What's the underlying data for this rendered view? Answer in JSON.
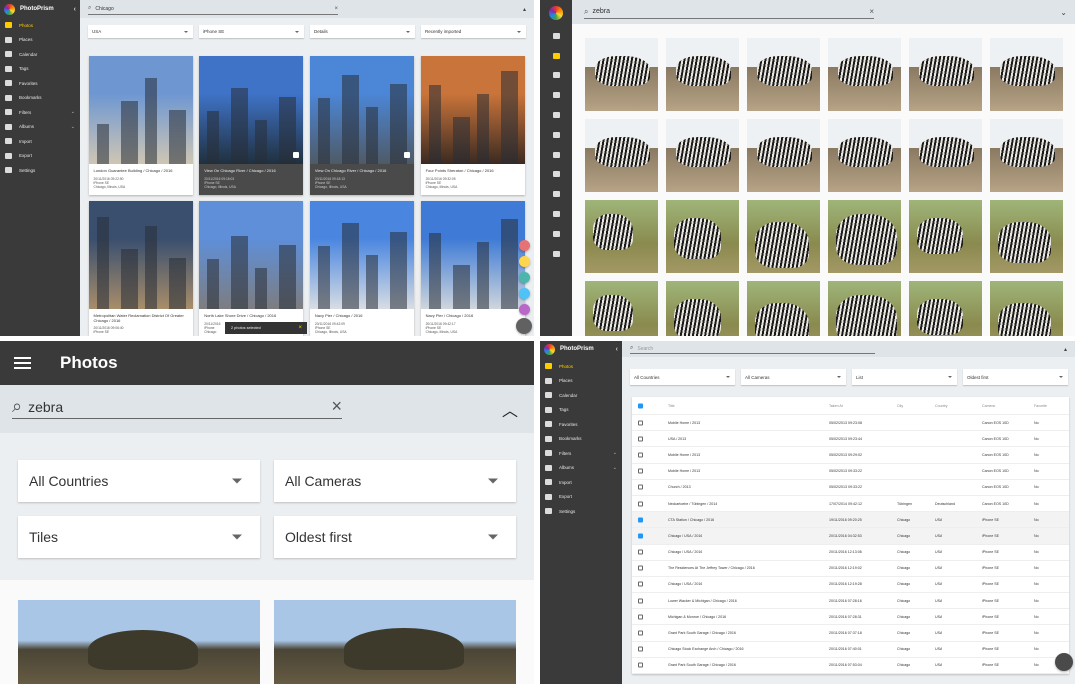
{
  "q1": {
    "brand": "PhotoPrism",
    "nav": [
      {
        "label": "Photos",
        "active": true
      },
      {
        "label": "Places"
      },
      {
        "label": "Calendar"
      },
      {
        "label": "Tags"
      },
      {
        "label": "Favorites"
      },
      {
        "label": "Bookmarks"
      },
      {
        "label": "Filters",
        "chevron": "⌄"
      },
      {
        "label": "Albums",
        "chevron": "⌄"
      },
      {
        "label": "Import"
      },
      {
        "label": "Export"
      },
      {
        "label": "Settings"
      }
    ],
    "search_value": "Chicago",
    "filters": [
      "USA",
      "iPhone SE",
      "Details",
      "Recently imported"
    ],
    "cards": [
      {
        "caption": "London Guarantee Building / Chicago / 2016",
        "meta": [
          "20/11/2016 09:22:50",
          "iPhone SE",
          "Chicago, Illinois, USA"
        ],
        "selected": false,
        "colors": [
          "#6e97d2",
          "#cfc6b4"
        ]
      },
      {
        "caption": "View On Chicago River / Chicago / 2016",
        "meta": [
          "20/11/2016 09:18:03",
          "iPhone SE",
          "Chicago, Illinois, USA"
        ],
        "selected": true,
        "colors": [
          "#3f73c7",
          "#20303e"
        ]
      },
      {
        "caption": "View On Chicago River / Chicago / 2016",
        "meta": [
          "20/11/2016 09:18:13",
          "iPhone SE",
          "Chicago, Illinois, USA"
        ],
        "selected": true,
        "colors": [
          "#4c86d6",
          "#4f5a66"
        ]
      },
      {
        "caption": "Four Points Sheraton / Chicago / 2016",
        "meta": [
          "20/11/2016 09:32:05",
          "iPhone SE",
          "Chicago, Illinois, USA"
        ],
        "selected": false,
        "colors": [
          "#c9743a",
          "#3b2a22"
        ]
      },
      {
        "caption": "Metropolitan Water Reclamation District Of Greater Chicago / 2016",
        "meta": [
          "20/11/2016 09:06:40",
          "iPhone SE"
        ],
        "selected": false,
        "colors": [
          "#3a4f6e",
          "#a88d6a"
        ]
      },
      {
        "caption": "North Lake Shore Drive / Chicago / 2016",
        "meta": [
          "20/11/2016",
          "iPhone",
          "Chicago"
        ],
        "selected": false,
        "colors": [
          "#5f8fd8",
          "#7d7d80"
        ]
      },
      {
        "caption": "Navy Pier / Chicago / 2016",
        "meta": [
          "20/11/2016 09:42:09",
          "iPhone SE",
          "Chicago, Illinois, USA"
        ],
        "selected": false,
        "colors": [
          "#4a86e0",
          "#d8dde3"
        ]
      },
      {
        "caption": "Navy Pier / Chicago / 2016",
        "meta": [
          "20/11/2016 09:42:17",
          "iPhone SE",
          "Chicago, Illinois, USA"
        ],
        "selected": false,
        "colors": [
          "#3f7bd6",
          "#cfd6dc"
        ]
      }
    ],
    "snackbar": "2 photos selected",
    "fab_colors": [
      "#e57373",
      "#ffd54f",
      "#4db6ac",
      "#4fc3f7",
      "#ba68c8",
      "#616161"
    ]
  },
  "q2": {
    "search_value": "zebra"
  },
  "q3": {
    "title": "Photos",
    "search_value": "zebra",
    "filters": [
      "All Countries",
      "All Cameras",
      "Tiles",
      "Oldest first"
    ]
  },
  "q4": {
    "brand": "PhotoPrism",
    "nav": [
      {
        "label": "Photos",
        "active": true
      },
      {
        "label": "Places"
      },
      {
        "label": "Calendar"
      },
      {
        "label": "Tags"
      },
      {
        "label": "Favorites"
      },
      {
        "label": "Bookmarks"
      },
      {
        "label": "Filters",
        "chevron": "⌄"
      },
      {
        "label": "Albums",
        "chevron": "⌄"
      },
      {
        "label": "Import"
      },
      {
        "label": "Export"
      },
      {
        "label": "Settings"
      }
    ],
    "search_placeholder": "Search",
    "filters": [
      "All Countries",
      "All Cameras",
      "List",
      "Oldest first"
    ],
    "columns": [
      "Title",
      "Taken At",
      "City",
      "Country",
      "Camera",
      "Favorite"
    ],
    "rows": [
      {
        "checked": false,
        "cells": [
          "Mobile Home / 2013",
          "05/02/2013 09:23:08",
          "",
          "",
          "Canon EOS 10D",
          "No"
        ]
      },
      {
        "checked": false,
        "cells": [
          "USA / 2013",
          "05/02/2013 09:23:44",
          "",
          "",
          "Canon EOS 10D",
          "No"
        ]
      },
      {
        "checked": false,
        "cells": [
          "Mobile Home / 2013",
          "05/02/2013 09:29:02",
          "",
          "",
          "Canon EOS 10D",
          "No"
        ]
      },
      {
        "checked": false,
        "cells": [
          "Mobile Home / 2013",
          "05/02/2013 09:33:22",
          "",
          "",
          "Canon EOS 10D",
          "No"
        ]
      },
      {
        "checked": false,
        "cells": [
          "Church / 2013",
          "05/02/2013 09:33:22",
          "",
          "",
          "Canon EOS 10D",
          "No"
        ]
      },
      {
        "checked": false,
        "cells": [
          "Neckartoebe / Tübingen / 2014",
          "17/07/2014 09:42:12",
          "Tübingen",
          "Deutschland",
          "Canon EOS 10D",
          "No"
        ]
      },
      {
        "checked": true,
        "cells": [
          "CTA Station / Chicago / 2016",
          "19/11/2016 09:20:25",
          "Chicago",
          "USA",
          "iPhone SE",
          "No"
        ]
      },
      {
        "checked": true,
        "cells": [
          "Chicago / USA / 2016",
          "20/11/2016 04:32:53",
          "Chicago",
          "USA",
          "iPhone SE",
          "No"
        ]
      },
      {
        "checked": false,
        "cells": [
          "Chicago / USA / 2016",
          "20/11/2016 12:13:06",
          "Chicago",
          "USA",
          "iPhone SE",
          "No"
        ]
      },
      {
        "checked": false,
        "cells": [
          "The Residences At The Jeffrey Tower / Chicago / 2016",
          "20/11/2016 12:19:02",
          "Chicago",
          "USA",
          "iPhone SE",
          "No"
        ]
      },
      {
        "checked": false,
        "cells": [
          "Chicago / USA / 2016",
          "20/11/2016 12:19:28",
          "Chicago",
          "USA",
          "iPhone SE",
          "No"
        ]
      },
      {
        "checked": false,
        "cells": [
          "Lower Wacker & Michigan / Chicago / 2016",
          "20/11/2016 07:28:16",
          "Chicago",
          "USA",
          "iPhone SE",
          "No"
        ]
      },
      {
        "checked": false,
        "cells": [
          "Michigan & Monroe / Chicago / 2016",
          "20/11/2016 07:28:31",
          "Chicago",
          "USA",
          "iPhone SE",
          "No"
        ]
      },
      {
        "checked": false,
        "cells": [
          "Grant Park South Garage / Chicago / 2016",
          "20/11/2016 07:37:18",
          "Chicago",
          "USA",
          "iPhone SE",
          "No"
        ]
      },
      {
        "checked": false,
        "cells": [
          "Chicago Stock Exchange Arch / Chicago / 2016",
          "20/11/2016 07:40:01",
          "Chicago",
          "USA",
          "iPhone SE",
          "No"
        ]
      },
      {
        "checked": false,
        "cells": [
          "Grant Park South Garage / Chicago / 2016",
          "20/11/2016 07:53:04",
          "Chicago",
          "USA",
          "iPhone SE",
          "No"
        ]
      }
    ]
  }
}
